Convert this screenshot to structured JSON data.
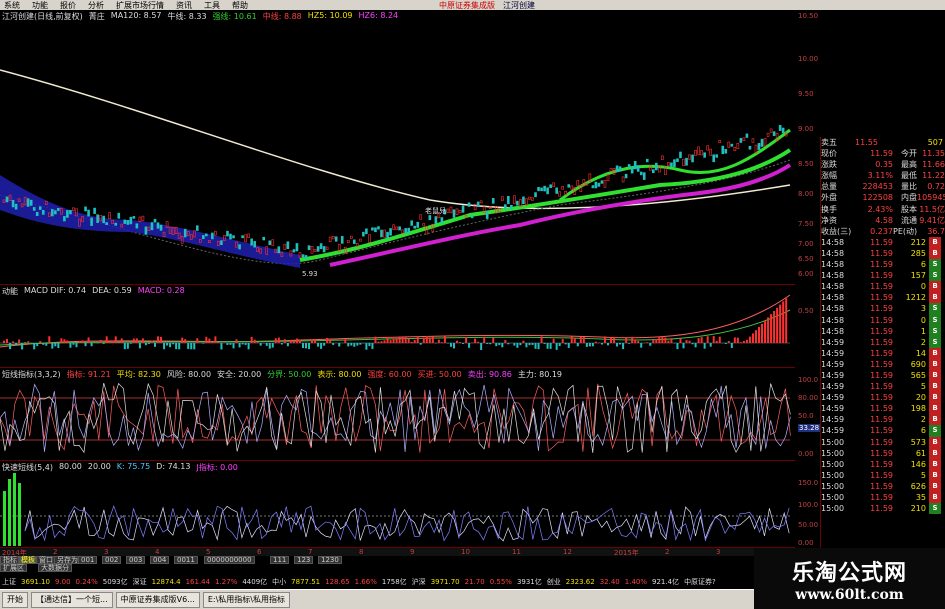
{
  "menu": [
    "系统",
    "功能",
    "报价",
    "分析",
    "扩展市场行情",
    "资讯",
    "工具",
    "帮助"
  ],
  "brand": {
    "name": "中原证券集成版",
    "tag": "江河创建"
  },
  "main_panel": {
    "title": "江河创建(日线,前复权)",
    "tag": "菁庄",
    "ma120": "MA120: 8.57",
    "ma_label": "牛线: 8.33",
    "fields": [
      "强线: 10.61",
      "中线: 8.88",
      "HZ5: 10.09",
      "HZ6: 8.24"
    ],
    "low_mark": "5.93",
    "note": "老鼠兒",
    "axis": [
      "10.50",
      "10.00",
      "9.50",
      "9.00",
      "8.50",
      "8.00",
      "7.50",
      "7.00",
      "6.50",
      "6.00"
    ]
  },
  "macd_panel": {
    "title": "动能",
    "fields": [
      "MACD DIF: 0.74",
      "DEA: 0.59",
      "MACD: 0.28"
    ],
    "axis": [
      "0.50"
    ]
  },
  "kdj_panel": {
    "title": "短线指标(3,3,2)",
    "fields": [
      "指标: 91.21",
      "平均: 82.30",
      "风险: 80.00",
      "安全: 20.00",
      "分界: 50.00",
      "表示: 80.00"
    ],
    "extra": [
      "强度: 60.00",
      "买进: 50.00",
      "卖出: 90.86",
      "主力: 80.19"
    ],
    "axis": [
      "100.0",
      "80.00",
      "50.0",
      "33.28",
      "0.00"
    ]
  },
  "kd_panel": {
    "title": "快速短线(5,4)",
    "fields": [
      "80.00",
      "20.00",
      "K: 75.75",
      "D: 74.13",
      "J指标: 0.00"
    ],
    "axis": [
      "150.0",
      "100.0",
      "50.00",
      "0.00"
    ]
  },
  "quote": {
    "sell5": "11.55",
    "sell5_vol": "507",
    "rows": [
      {
        "k": "现价",
        "v": "11.59",
        "k2": "今开",
        "v2": "11.35"
      },
      {
        "k": "涨跌",
        "v": "0.35",
        "k2": "最高",
        "v2": "11.66"
      },
      {
        "k": "涨幅",
        "v": "3.11%",
        "k2": "最低",
        "v2": "11.22"
      },
      {
        "k": "总量",
        "v": "228453",
        "k2": "量比",
        "v2": "0.72"
      },
      {
        "k": "外盘",
        "v": "122508",
        "k2": "内盘",
        "v2": "105945"
      },
      {
        "k": "换手",
        "v": "2.43%",
        "k2": "股本",
        "v2": "11.5亿"
      },
      {
        "k": "净资",
        "v": "4.58",
        "k2": "流通",
        "v2": "9.41亿"
      },
      {
        "k": "收益(三)",
        "v": "0.237",
        "k2": "PE(动)",
        "v2": "36.7"
      }
    ],
    "ticks": [
      [
        "14:58",
        "11.59",
        "212",
        "B"
      ],
      [
        "14:58",
        "11.59",
        "285",
        "B"
      ],
      [
        "14:58",
        "11.59",
        "6",
        "S"
      ],
      [
        "14:58",
        "11.59",
        "157",
        "S"
      ],
      [
        "14:58",
        "11.59",
        "0",
        "B"
      ],
      [
        "14:58",
        "11.59",
        "1212",
        "B"
      ],
      [
        "14:58",
        "11.59",
        "3",
        "S"
      ],
      [
        "14:58",
        "11.59",
        "0",
        "S"
      ],
      [
        "14:58",
        "11.59",
        "1",
        "S"
      ],
      [
        "14:59",
        "11.59",
        "2",
        "S"
      ],
      [
        "14:59",
        "11.59",
        "14",
        "B"
      ],
      [
        "14:59",
        "11.59",
        "690",
        "B"
      ],
      [
        "14:59",
        "11.59",
        "565",
        "B"
      ],
      [
        "14:59",
        "11.59",
        "5",
        "B"
      ],
      [
        "14:59",
        "11.59",
        "20",
        "B"
      ],
      [
        "14:59",
        "11.59",
        "198",
        "B"
      ],
      [
        "14:59",
        "11.59",
        "2",
        "B"
      ],
      [
        "14:59",
        "11.59",
        "6",
        "S"
      ],
      [
        "15:00",
        "11.59",
        "573",
        "B"
      ],
      [
        "15:00",
        "11.59",
        "61",
        "B"
      ],
      [
        "15:00",
        "11.59",
        "146",
        "B"
      ],
      [
        "15:00",
        "11.59",
        "5",
        "B"
      ],
      [
        "15:00",
        "11.59",
        "626",
        "B"
      ],
      [
        "15:00",
        "11.59",
        "35",
        "B"
      ],
      [
        "15:00",
        "11.59",
        "210",
        "S"
      ]
    ]
  },
  "xaxis": [
    "2014年",
    "2",
    "3",
    "4",
    "5",
    "6",
    "7",
    "8",
    "9",
    "10",
    "11",
    "12",
    "2015年",
    "2",
    "3"
  ],
  "tabs": [
    "指标",
    "模板",
    "窗口",
    "另存为",
    "001",
    "002",
    "003",
    "004",
    "0011",
    "0000000000",
    "111",
    "123",
    "1230"
  ],
  "tabs2": [
    "扩展区",
    "大数据分"
  ],
  "ticker": [
    {
      "t": "上证",
      "v": "3691.10",
      "c": "y"
    },
    {
      "t": "",
      "v": "9.00",
      "c": "r"
    },
    {
      "t": "",
      "v": "0.24%",
      "c": "r"
    },
    {
      "t": "",
      "v": "5093亿",
      "c": "w"
    },
    {
      "t": "深证",
      "v": "12874.4",
      "c": "y"
    },
    {
      "t": "",
      "v": "161.44",
      "c": "r"
    },
    {
      "t": "",
      "v": "1.27%",
      "c": "r"
    },
    {
      "t": "",
      "v": "4409亿",
      "c": "w"
    },
    {
      "t": "中小",
      "v": "7877.51",
      "c": "y"
    },
    {
      "t": "",
      "v": "128.65",
      "c": "r"
    },
    {
      "t": "",
      "v": "1.66%",
      "c": "r"
    },
    {
      "t": "",
      "v": "1758亿",
      "c": "w"
    },
    {
      "t": "沪深",
      "v": "3971.70",
      "c": "y"
    },
    {
      "t": "",
      "v": "21.70",
      "c": "r"
    },
    {
      "t": "",
      "v": "0.55%",
      "c": "r"
    },
    {
      "t": "",
      "v": "3931亿",
      "c": "w"
    },
    {
      "t": "创业",
      "v": "2323.62",
      "c": "y"
    },
    {
      "t": "",
      "v": "32.40",
      "c": "r"
    },
    {
      "t": "",
      "v": "1.40%",
      "c": "r"
    },
    {
      "t": "",
      "v": "921.4亿",
      "c": "w"
    },
    {
      "t": "",
      "v": "中原证券?",
      "c": "w"
    }
  ],
  "taskbar": [
    "开始",
    "【通达信】一个短...",
    "中原证券集成版V6...",
    "E:\\私用指标\\私用指标"
  ],
  "logo": {
    "title": "乐淘公式网",
    "url": "www.60lt.com"
  }
}
